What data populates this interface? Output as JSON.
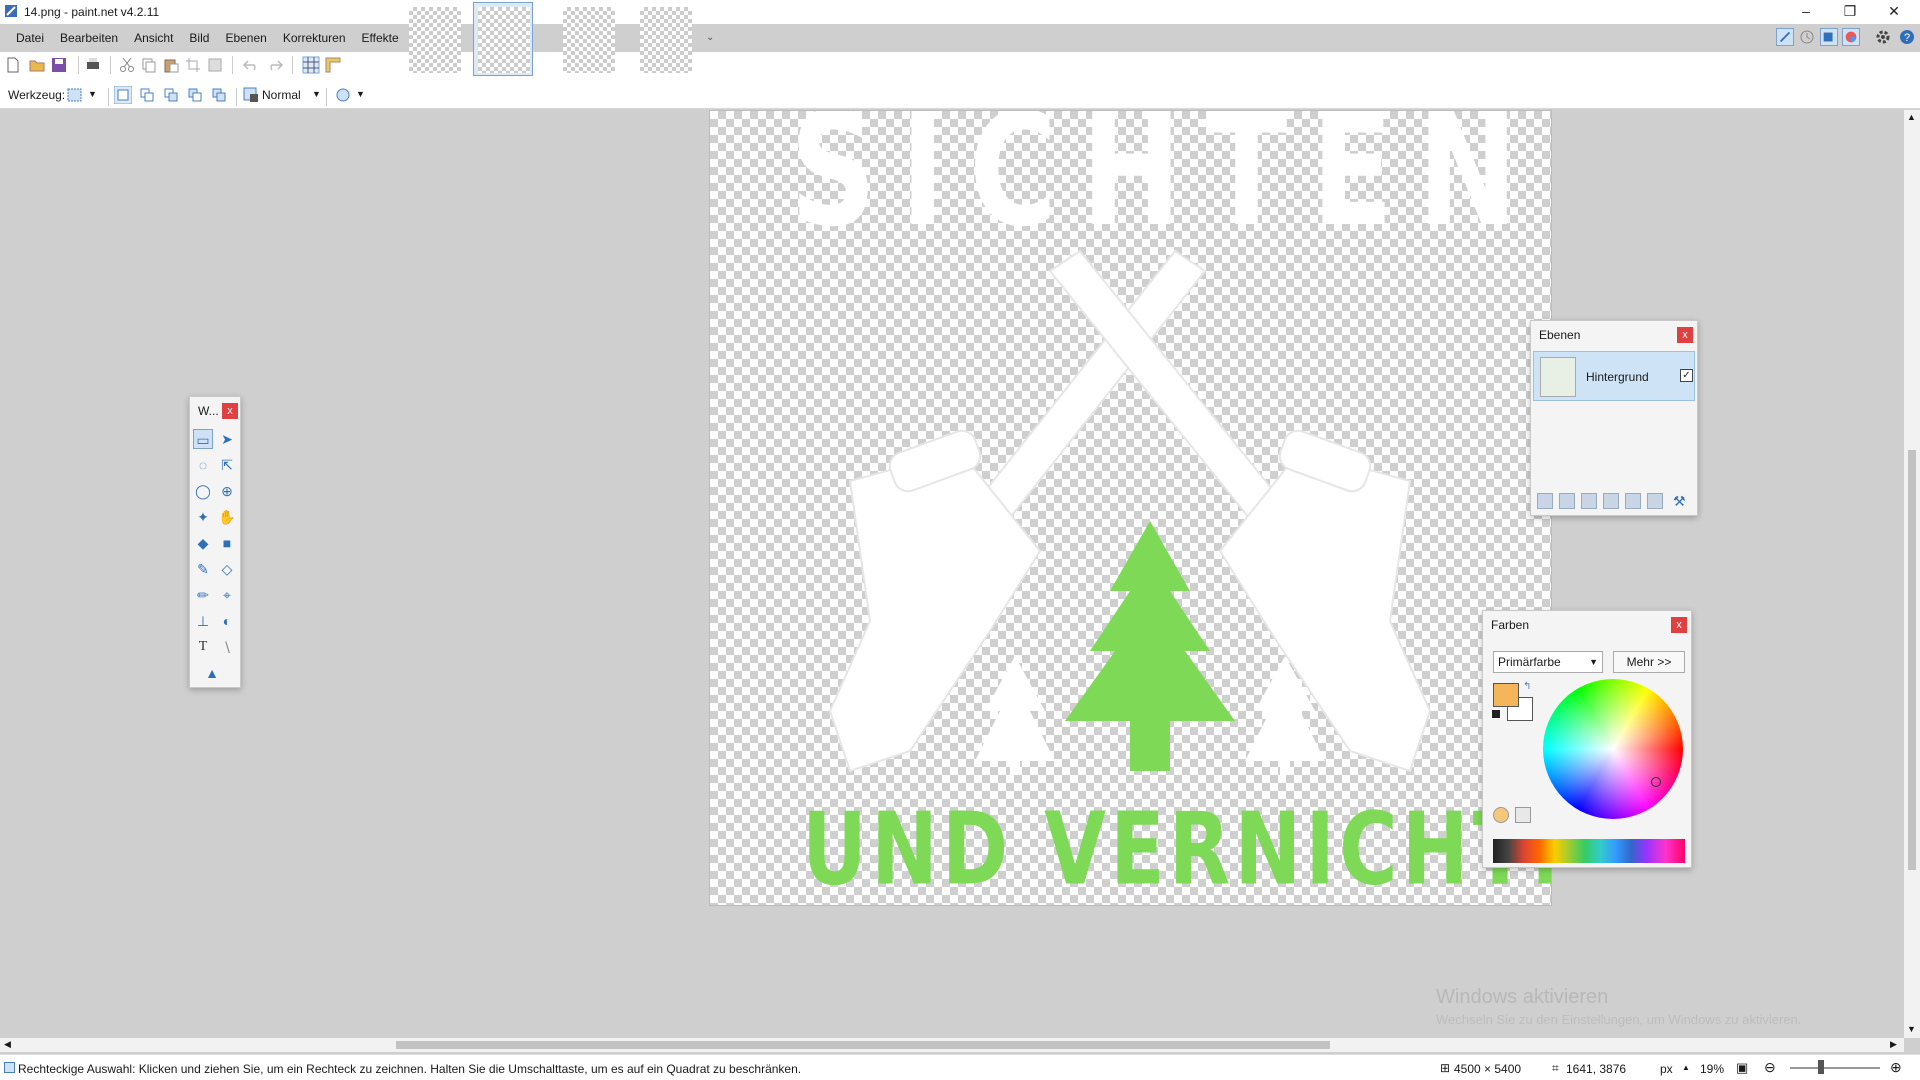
{
  "window": {
    "title": "14.png - paint.net v4.2.11",
    "minimize": "–",
    "restore": "❐",
    "close": "✕"
  },
  "menu": [
    "Datei",
    "Bearbeiten",
    "Ansicht",
    "Bild",
    "Ebenen",
    "Korrekturen",
    "Effekte"
  ],
  "thumbnails": [
    {
      "name": "image-1",
      "active": false
    },
    {
      "name": "image-2",
      "active": true
    },
    {
      "name": "image-3",
      "active": false
    },
    {
      "name": "image-4",
      "active": false
    }
  ],
  "toolbar": {
    "tool_label": "Werkzeug:",
    "blend_mode": "Normal"
  },
  "canvas": {
    "top_text": "SICHTEN",
    "bottom_text": "UND VERNICHTEN",
    "colors": {
      "green": "#7ed957",
      "white": "#ffffff"
    }
  },
  "tools_window": {
    "title": "W...",
    "close": "x"
  },
  "layers_window": {
    "title": "Ebenen",
    "close": "x",
    "layers": [
      {
        "name": "Hintergrund",
        "visible": true
      }
    ]
  },
  "colors_window": {
    "title": "Farben",
    "close": "x",
    "selector": "Primärfarbe",
    "more_button": "Mehr >>",
    "primary_color": "#f5b55a",
    "secondary_color": "#ffffff"
  },
  "watermark": {
    "title": "Windows aktivieren",
    "subtitle": "Wechseln Sie zu den Einstellungen, um Windows zu aktivieren."
  },
  "status": {
    "hint": "Rechteckige Auswahl: Klicken und ziehen Sie, um ein Rechteck zu zeichnen. Halten Sie die Umschalttaste, um es auf ein Quadrat zu beschränken.",
    "image_size": "4500 × 5400",
    "cursor_pos": "1641, 3876",
    "unit": "px",
    "zoom": "19%"
  }
}
